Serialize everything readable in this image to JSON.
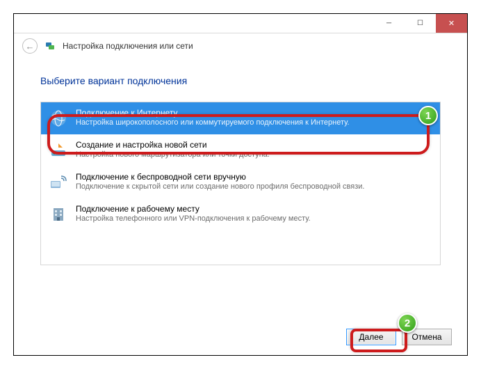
{
  "window": {
    "title": "Настройка подключения или сети"
  },
  "instruction": "Выберите вариант подключения",
  "options": [
    {
      "title": "Подключение к Интернету",
      "desc": "Настройка широкополосного или коммутируемого подключения к Интернету.",
      "selected": true
    },
    {
      "title": "Создание и настройка новой сети",
      "desc": "Настройка нового маршрутизатора или точки доступа."
    },
    {
      "title": "Подключение к беспроводной сети вручную",
      "desc": "Подключение к скрытой сети или создание нового профиля беспроводной связи."
    },
    {
      "title": "Подключение к рабочему месту",
      "desc": "Настройка телефонного или VPN-подключения к рабочему месту."
    }
  ],
  "buttons": {
    "next": "Далее",
    "cancel": "Отмена"
  },
  "badges": {
    "one": "1",
    "two": "2"
  }
}
